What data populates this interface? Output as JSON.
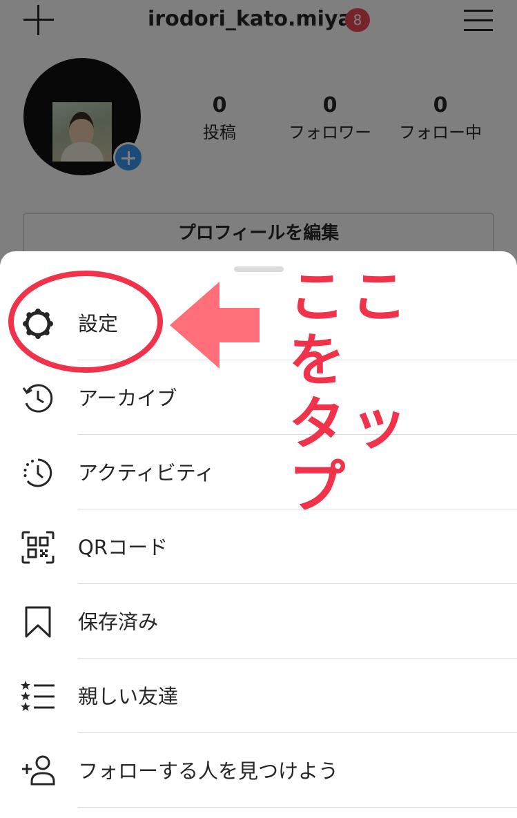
{
  "header": {
    "username": "irodori_kato.miya",
    "notification_count": "8"
  },
  "stats": [
    {
      "value": "0",
      "label": "投稿"
    },
    {
      "value": "0",
      "label": "フォロワー"
    },
    {
      "value": "0",
      "label": "フォロー中"
    }
  ],
  "profile": {
    "edit_button": "プロフィールを編集"
  },
  "menu": {
    "items": [
      {
        "label": "設定",
        "icon": "settings-gear-icon"
      },
      {
        "label": "アーカイブ",
        "icon": "archive-history-icon"
      },
      {
        "label": "アクティビティ",
        "icon": "activity-clock-icon"
      },
      {
        "label": "QRコード",
        "icon": "qr-code-icon"
      },
      {
        "label": "保存済み",
        "icon": "bookmark-icon"
      },
      {
        "label": "親しい友達",
        "icon": "close-friends-list-icon"
      },
      {
        "label": "フォローする人を見つけよう",
        "icon": "add-person-icon"
      }
    ]
  },
  "annotation": {
    "text_line1": "ここを",
    "text_line2": "タップ",
    "color": "#f0324b"
  },
  "colors": {
    "badge": "#ed4956",
    "accent": "#3897f0"
  }
}
